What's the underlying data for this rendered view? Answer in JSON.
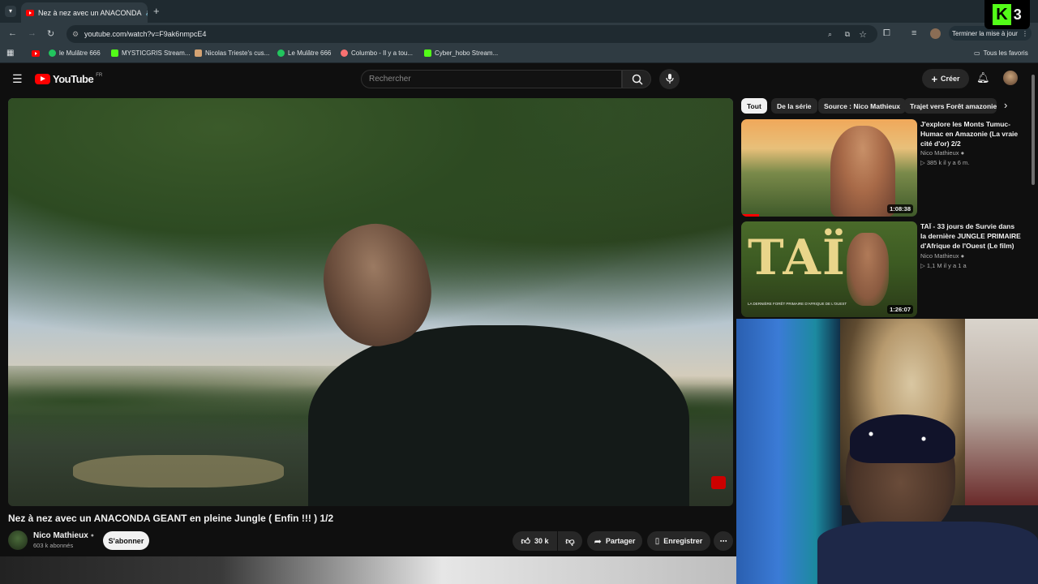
{
  "browser": {
    "tab_title": "Nez à nez avec un ANACONDA",
    "url": "youtube.com/watch?v=F9ak6nmpcE4",
    "update_label": "Terminer la mise à jour",
    "all_bookmarks_label": "Tous les favoris",
    "bookmarks": [
      {
        "label": "le Mulâtre 666",
        "color": "#22c55e"
      },
      {
        "label": "MYSTICGRIS Stream...",
        "color": "#53fc18"
      },
      {
        "label": "Nicolas Trieste's cus...",
        "color": "#d4a373"
      },
      {
        "label": "Le Mulâtre 666",
        "color": "#22c55e"
      },
      {
        "label": "Columbo - Il y a tou...",
        "color": "#f87171"
      },
      {
        "label": "Cyber_hobo Stream...",
        "color": "#53fc18"
      }
    ]
  },
  "overlay": {
    "logo_letter": "K",
    "logo_number": "3"
  },
  "youtube": {
    "logo_text": "YouTube",
    "region": "FR",
    "search_placeholder": "Rechercher",
    "create_label": "Créer"
  },
  "video": {
    "title": "Nez à nez avec un ANACONDA GEANT en pleine Jungle ( Enfin !!! ) 1/2",
    "channel": "Nico Mathieux",
    "subscribers": "603 k abonnés",
    "subscribe_label": "S'abonner",
    "likes": "30 k",
    "share_label": "Partager",
    "save_label": "Enregistrer"
  },
  "chips": [
    "Tout",
    "De la série",
    "Source : Nico Mathieux",
    "Trajet vers Forêt amazonien"
  ],
  "recommendations": [
    {
      "title": "J'explore les Monts Tumuc-Humac en Amazonie (La vraie cité d'or) 2/2",
      "channel": "Nico Mathieux",
      "stats": "385 k   il y a 6 m.",
      "duration": "1:08:38",
      "progress": 0.1
    },
    {
      "title": "TAÏ - 33 jours de Survie dans la dernière JUNGLE PRIMAIRE d'Afrique de l'Ouest (Le film)",
      "channel": "Nico Mathieux",
      "stats": "1,1 M   il y a 1 a",
      "duration": "1:26:07",
      "thumb_text": "TAÏ",
      "thumb_caption": "LA DERNIÈRE FORÊT PRIMAIRE D'AFRIQUE DE L'OUEST"
    }
  ],
  "colors": {
    "accent": "#ff0000",
    "background": "#0f0f0f"
  }
}
